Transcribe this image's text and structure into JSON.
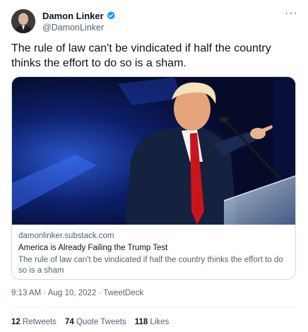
{
  "author": {
    "name": "Damon Linker",
    "handle": "@DamonLinker"
  },
  "tweet": {
    "text": "The rule of law can't be vindicated if half the country thinks the effort to do so is a sham.",
    "time": "9:13 AM",
    "date": "Aug 10, 2022",
    "source": "TweetDeck"
  },
  "card": {
    "domain": "damonlinker.substack.com",
    "title": "America is Already Failing the Trump Test",
    "description": "The rule of law can't be vindicated if half the country thinks the effort to do so is a sham"
  },
  "stats": {
    "retweets_count": "12",
    "retweets_label": "Retweets",
    "quotes_count": "74",
    "quotes_label": "Quote Tweets",
    "likes_count": "118",
    "likes_label": "Likes"
  },
  "colors": {
    "verified": "#1d9bf0",
    "muted": "#536471",
    "text": "#0f1419"
  },
  "icons": {
    "verified": "verified-badge-icon",
    "more": "more-options-icon"
  }
}
